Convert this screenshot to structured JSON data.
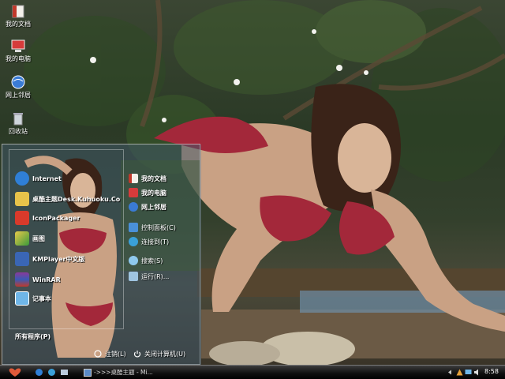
{
  "desktop": {
    "icons": [
      {
        "label": "我的文档",
        "icon": "documents-folder-icon"
      },
      {
        "label": "我的电脑",
        "icon": "computer-icon"
      },
      {
        "label": "网上邻居",
        "icon": "network-icon"
      },
      {
        "label": "回收站",
        "icon": "recycle-bin-icon"
      }
    ]
  },
  "start_menu": {
    "pinned": [
      {
        "label": "Internet",
        "icon": "ie-icon"
      },
      {
        "label": "桌酷主题Desk.Kuhuoku.Com",
        "icon": "theme-icon"
      },
      {
        "label": "IconPackager",
        "icon": "iconpackager-icon"
      },
      {
        "label": "画图",
        "icon": "paint-icon"
      },
      {
        "label": "KMPlayer中文版",
        "icon": "kmplayer-icon"
      },
      {
        "label": "WinRAR",
        "icon": "winrar-icon"
      },
      {
        "label": "记事本",
        "icon": "notepad-icon"
      }
    ],
    "places": [
      {
        "label": "我的文档",
        "icon": "documents-icon"
      },
      {
        "label": "我的电脑",
        "icon": "computer-icon"
      },
      {
        "label": "网上邻居",
        "icon": "network-icon"
      },
      {
        "label": "控制面板(C)",
        "icon": "control-panel-icon"
      },
      {
        "label": "连接到(T)",
        "icon": "connect-icon"
      },
      {
        "label": "搜索(S)",
        "icon": "search-icon"
      },
      {
        "label": "运行(R)...",
        "icon": "run-icon"
      }
    ],
    "all_programs": "所有程序(P)",
    "logoff": "注销(L)",
    "shutdown": "关闭计算机(U)"
  },
  "taskbar": {
    "window_title": "->>>桌酷主题 - Mi...",
    "clock": "8:58"
  },
  "colors": {
    "taskbar": "#000000",
    "menu_border": "#ffffff",
    "bikini": "#a3283a"
  }
}
